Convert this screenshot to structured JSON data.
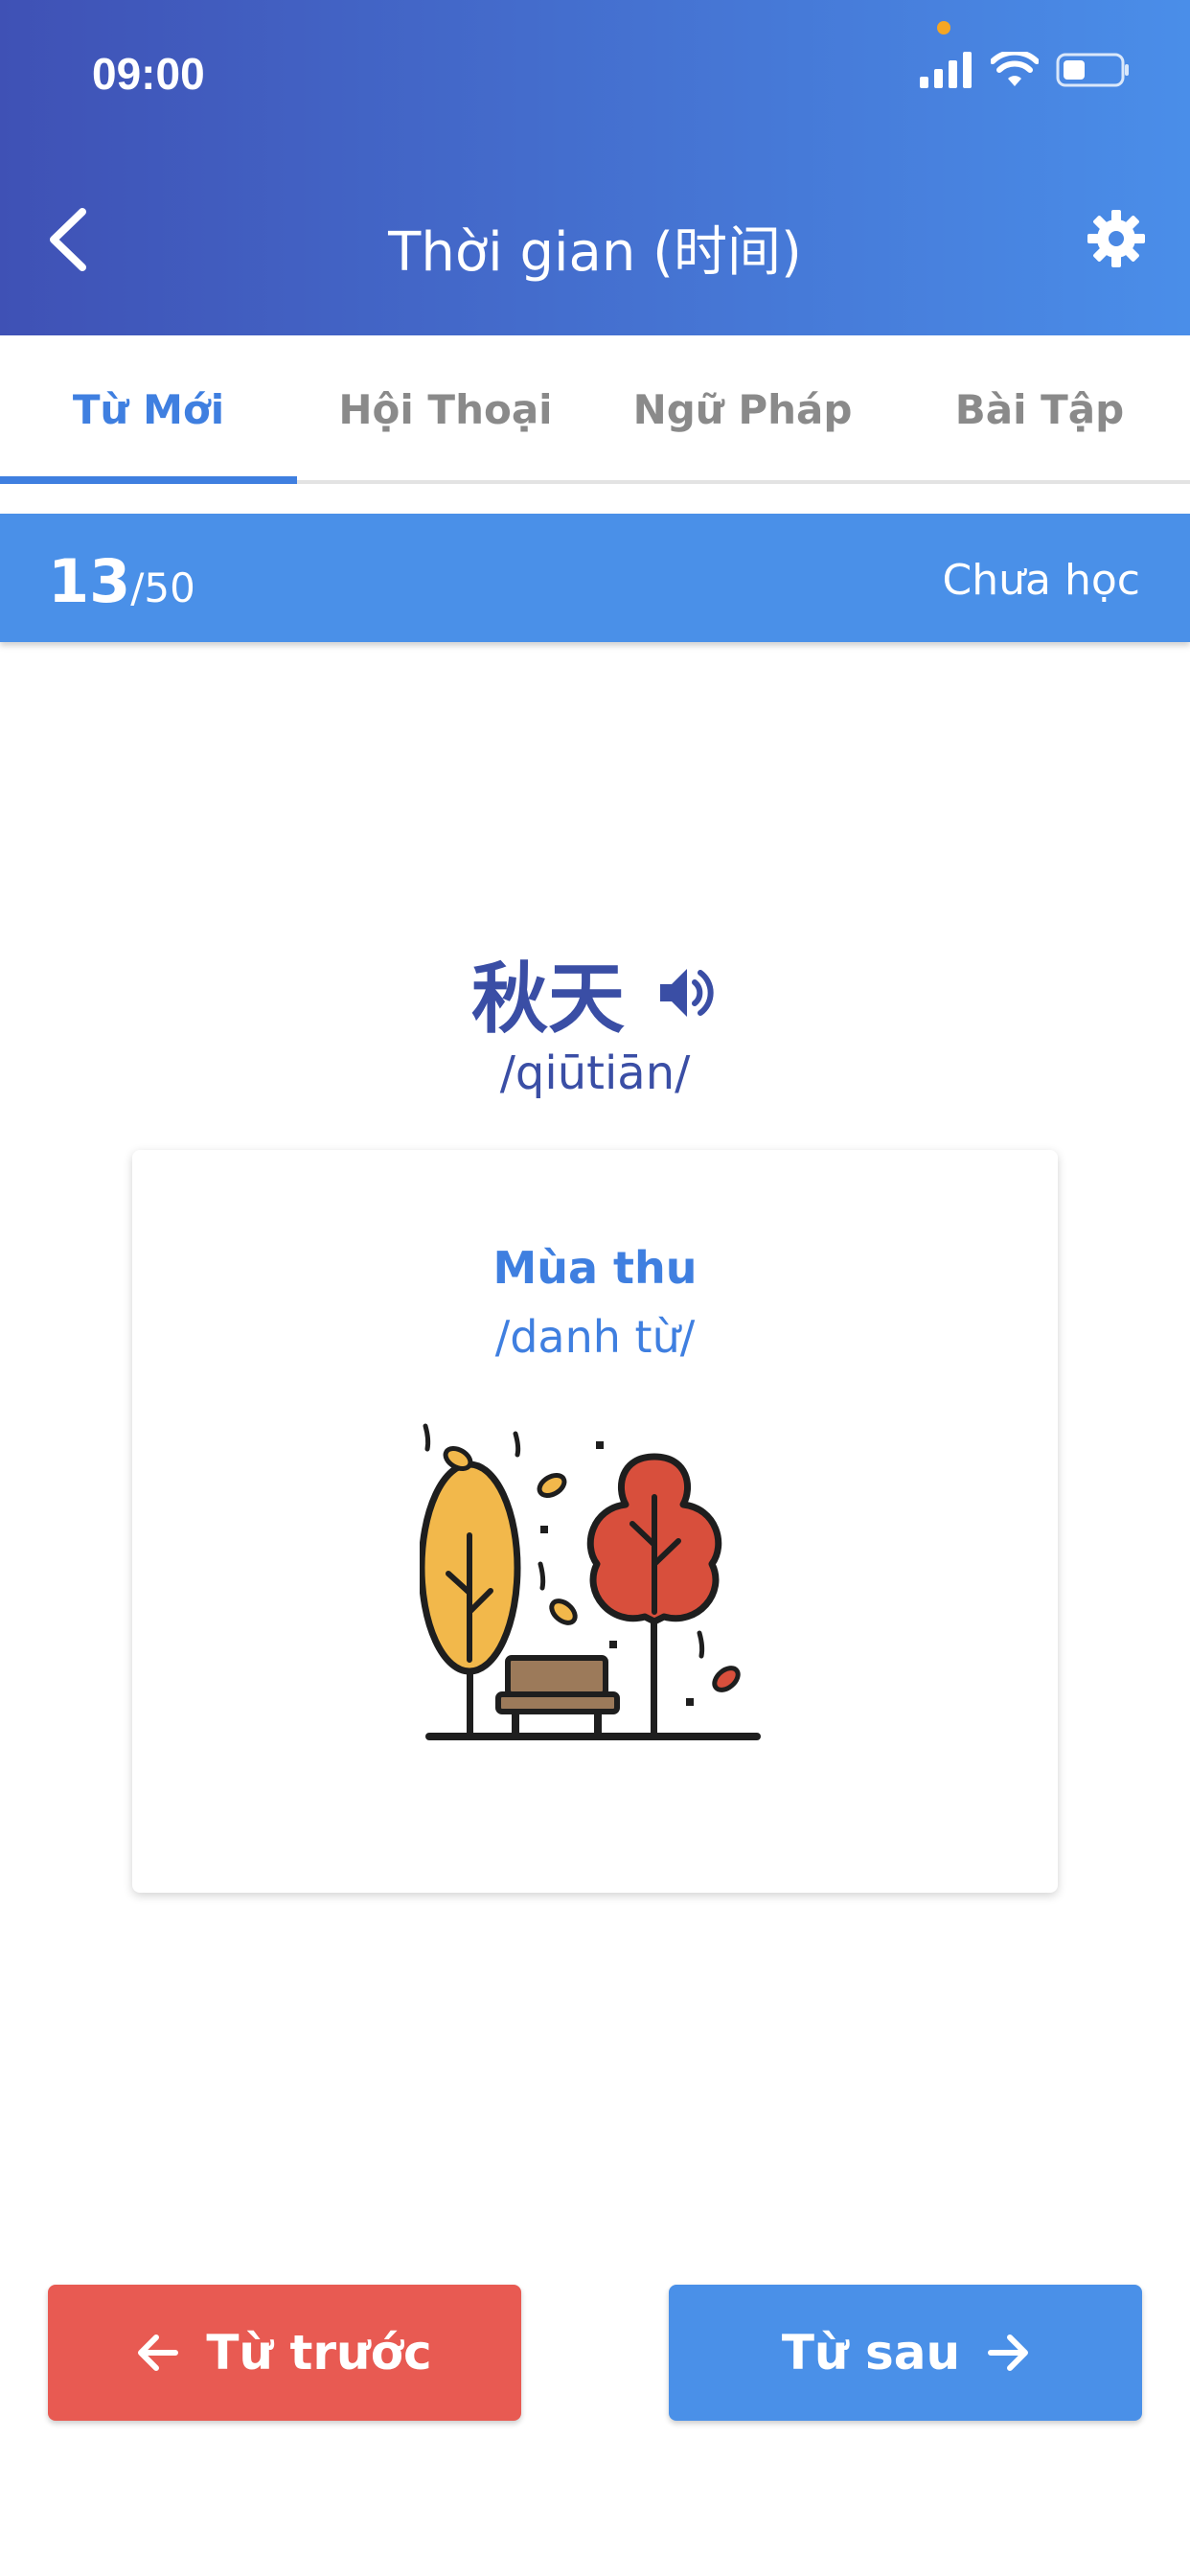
{
  "status_bar": {
    "time": "09:00"
  },
  "header": {
    "title": "Thời gian (时间)"
  },
  "tabs": [
    {
      "label": "Từ Mới",
      "active": true
    },
    {
      "label": "Hội Thoại",
      "active": false
    },
    {
      "label": "Ngữ Pháp",
      "active": false
    },
    {
      "label": "Bài Tập",
      "active": false
    }
  ],
  "progress": {
    "current": "13",
    "total": "/50",
    "status": "Chưa học"
  },
  "word": {
    "hanzi": "秋天",
    "pinyin": "/qiūtiān/",
    "meaning": "Mùa thu",
    "word_type": "/danh từ/",
    "illustration": "autumn-park-icon"
  },
  "buttons": {
    "prev_label": "Từ trước",
    "next_label": "Từ sau"
  },
  "colors": {
    "header_start": "#3f51b5",
    "header_end": "#4a8ee9",
    "accent": "#3f7fe0",
    "prev_button": "#e85a52",
    "next_button": "#4a90e8",
    "hanzi": "#3a4ea5"
  }
}
